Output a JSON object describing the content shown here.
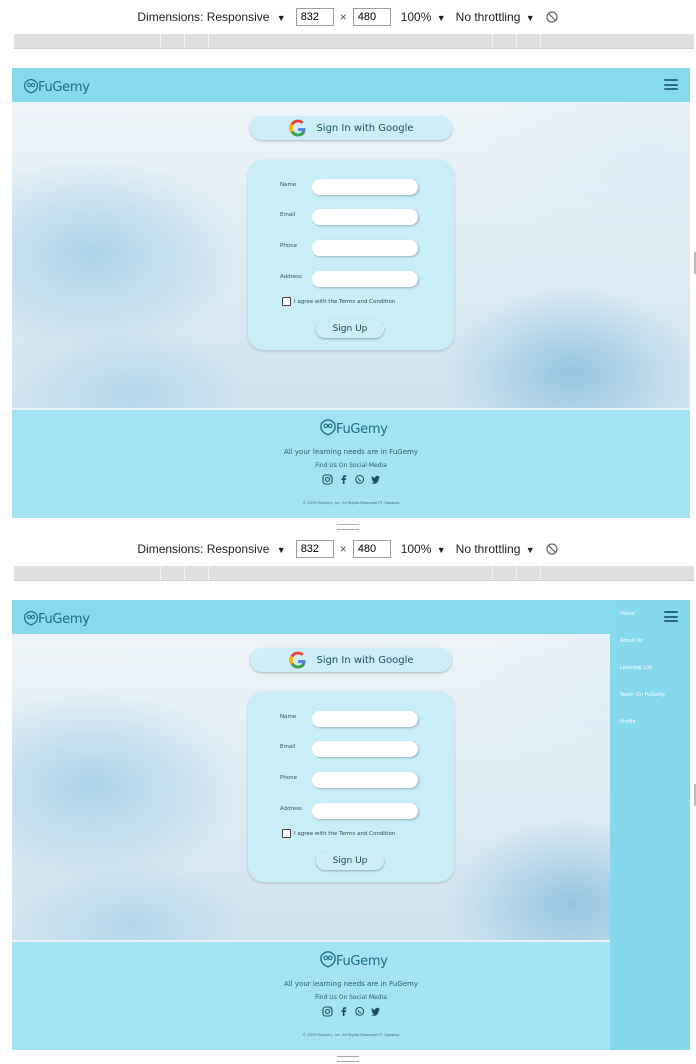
{
  "devtools": {
    "dimensions_label": "Dimensions: Responsive",
    "caret": "▼",
    "width_value": "832",
    "times": "×",
    "height_value": "480",
    "zoom": "100%",
    "throttling": "No throttling"
  },
  "site": {
    "brand": "FuGemy",
    "google_button": "Sign In with Google",
    "form": {
      "fields": [
        {
          "label": "Name",
          "value": ""
        },
        {
          "label": "Email",
          "value": ""
        },
        {
          "label": "Phone",
          "value": ""
        },
        {
          "label": "Address",
          "value": ""
        }
      ],
      "agree_text": "I agree with the Terms and Condition",
      "submit": "Sign Up"
    },
    "footer": {
      "tagline": "All your learning needs are in FuGemy",
      "find_us": "Find Us On Social Media",
      "social_icons": [
        "instagram-icon",
        "facebook-icon",
        "whatsapp-icon",
        "twitter-icon"
      ],
      "copyright": "© 2019 FuGemy, Inc. All Rights Reserved PT. Sneakys"
    },
    "menu": {
      "items": [
        "Home",
        "About Us",
        "Learning List",
        "Teach On FuGemy",
        "Profile"
      ]
    },
    "colors": {
      "navbar": "#87d9ec",
      "footer": "#a3e3f4",
      "card": "#c9eef8",
      "side_menu": "#86d8ec"
    }
  }
}
